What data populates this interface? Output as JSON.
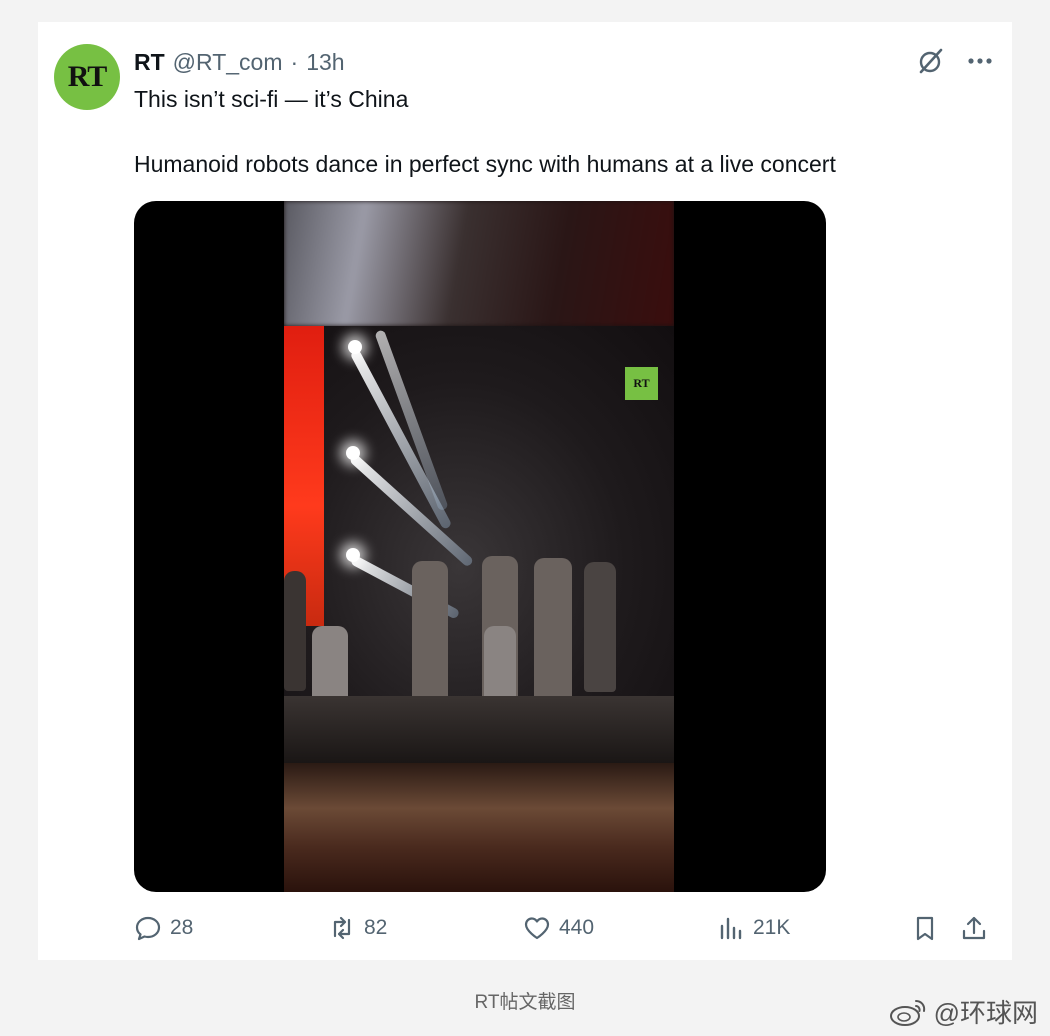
{
  "post": {
    "avatar_text": "RT",
    "author_name": "RT",
    "author_handle": "@RT_com",
    "separator": "·",
    "time": "13h",
    "text_line1": "This isn’t sci-fi — it’s China",
    "text_line2": "Humanoid robots dance in perfect sync with humans at a live concert",
    "video_badge": "RT"
  },
  "actions": {
    "replies": "28",
    "reposts": "82",
    "likes": "440",
    "views": "21K"
  },
  "footer": {
    "caption": "RT帖文截图",
    "watermark": "@环球网"
  },
  "icons": [
    "grok-icon",
    "more-icon",
    "reply-icon",
    "repost-icon",
    "like-icon",
    "views-icon",
    "bookmark-icon",
    "share-icon",
    "weibo-icon"
  ],
  "colors": {
    "brand_green": "#77c043",
    "secondary_text": "#536471",
    "stage_red": "#e01e10"
  }
}
